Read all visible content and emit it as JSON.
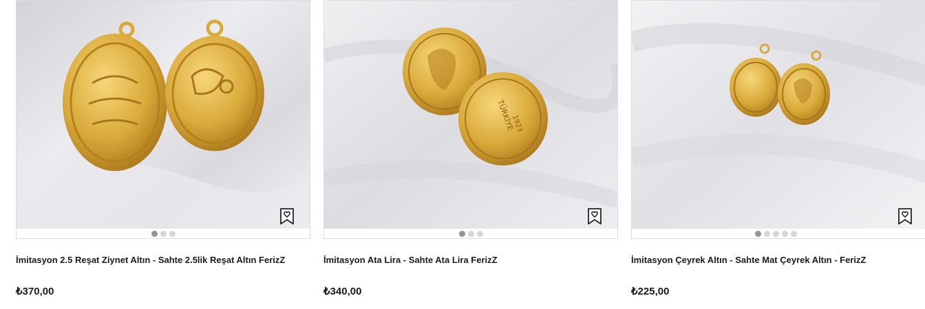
{
  "products": [
    {
      "title": "İmitasyon 2.5 Reşat Ziynet Altın - Sahte 2.5lik Reşat Altın FerizZ",
      "price": "₺370,00",
      "image_icon": "coin-pendant-photo",
      "dots": 3,
      "active_dot": 0
    },
    {
      "title": "İmitasyon Ata Lira - Sahte Ata Lira FerizZ",
      "price": "₺340,00",
      "image_icon": "coin-photo",
      "dots": 3,
      "active_dot": 0
    },
    {
      "title": "İmitasyon Çeyrek Altın - Sahte Mat Çeyrek Altın - FerizZ",
      "price": "₺225,00",
      "image_icon": "coin-pendant-photo",
      "dots": 5,
      "active_dot": 0
    }
  ],
  "colors": {
    "gold": "#d9a93a",
    "gold_dark": "#b5811c",
    "fabric": "#e6e6ea",
    "dot_active": "#8a9a98",
    "dot_inactive": "#d6d6d6"
  },
  "icons": {
    "favorite": "bookmark-heart-icon"
  }
}
